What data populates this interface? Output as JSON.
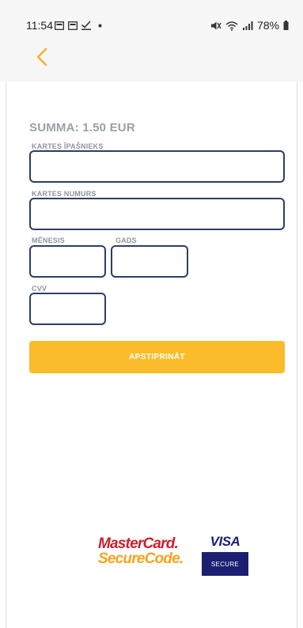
{
  "status_bar": {
    "time": "11:54",
    "battery": "78%"
  },
  "header": {
    "back_icon": "chevron-left-icon",
    "accent_color": "#f4b42a"
  },
  "payment": {
    "amount_text": "SUMMA: 1.50 EUR"
  },
  "form": {
    "cardholder_label": "KARTES ĪPAŠNIEKS",
    "cardholder_value": "",
    "card_number_label": "KARTES NUMURS",
    "card_number_value": "",
    "month_label": "MĒNESIS",
    "month_value": "",
    "year_label": "GADS",
    "year_value": "",
    "cvv_label": "CVV",
    "cvv_value": "",
    "field_border_color": "#2b3f66"
  },
  "confirm_button": {
    "label": "APSTIPRINĀT",
    "color": "#fbbc2b"
  },
  "logos": {
    "mastercard_line1": "MasterCard.",
    "mastercard_line2": "SecureCode.",
    "visa_word": "VISA",
    "visa_secure": "SECURE"
  }
}
